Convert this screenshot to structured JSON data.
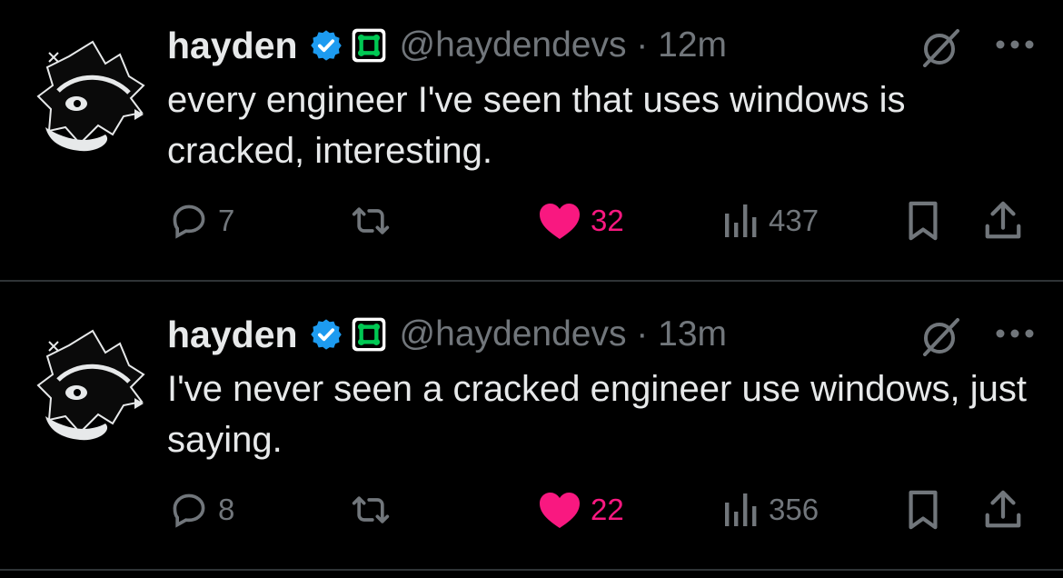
{
  "colors": {
    "background": "#000000",
    "text_primary": "#e7e9ea",
    "text_secondary": "#71767b",
    "like_active": "#f91880",
    "verified_blue": "#1d9bf0",
    "affiliate_green": "#00c853",
    "divider": "#2f3336"
  },
  "icons": {
    "reply": "speech-bubble",
    "retweet": "retweet-arrows",
    "like": "heart-filled",
    "views": "bar-chart",
    "bookmark": "bookmark",
    "share": "upload-arrow",
    "grok": "circle-slash",
    "more": "three-dots"
  },
  "tweets": [
    {
      "author_name": "hayden",
      "handle_time": "@haydendevs · 12m",
      "text": "every engineer I've seen that uses windows is cracked, interesting.",
      "replies": "7",
      "retweets": "",
      "likes": "32",
      "views": "437",
      "liked": true
    },
    {
      "author_name": "hayden",
      "handle_time": "@haydendevs · 13m",
      "text": "I've never seen a cracked engineer use windows, just saying.",
      "replies": "8",
      "retweets": "",
      "likes": "22",
      "views": "356",
      "liked": true
    }
  ]
}
